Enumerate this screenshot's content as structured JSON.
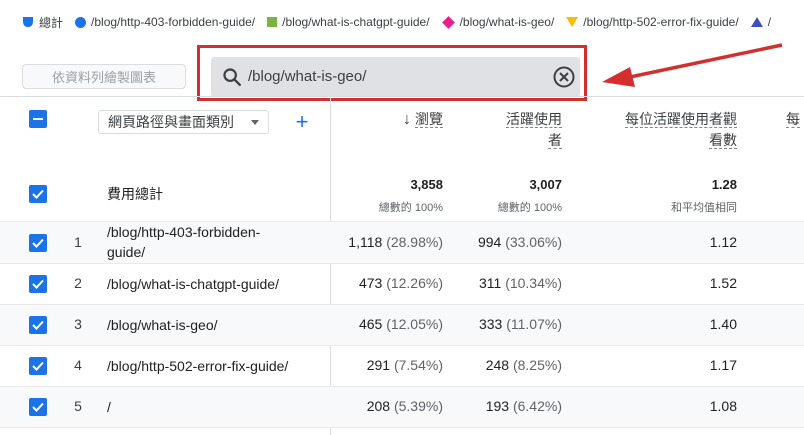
{
  "legend": [
    {
      "shape": "drop",
      "color": "#1a73e8",
      "label": "總計"
    },
    {
      "shape": "circle",
      "color": "#1a73e8",
      "label": "/blog/http-403-forbidden-guide/"
    },
    {
      "shape": "square",
      "color": "#7cb342",
      "label": "/blog/what-is-chatgpt-guide/"
    },
    {
      "shape": "diamond",
      "color": "#e91e8c",
      "label": "/blog/what-is-geo/"
    },
    {
      "shape": "tri-down",
      "color": "#fbbc04",
      "label": "/blog/http-502-error-fix-guide/"
    },
    {
      "shape": "tri-up",
      "color": "#3f51b5",
      "label": "/"
    }
  ],
  "toolbar": {
    "chart_button": "依資料列繪製圖表",
    "search_value": "/blog/what-is-geo/"
  },
  "colors": {
    "accent": "#1a73e8",
    "highlight": "#d32f2f",
    "annotation_arrow": "#d32f2f"
  },
  "table": {
    "dimension": "網頁路徑與畫面類別",
    "columns": [
      {
        "label": "瀏覽",
        "sorted": "desc",
        "sort_icon": "arrow-down-icon"
      },
      {
        "label_l1": "活躍使用",
        "label_l2": "者"
      },
      {
        "label_l1": "每位活躍使用者觀",
        "label_l2": "看數"
      },
      {
        "label": "每"
      }
    ],
    "totals": {
      "label": "費用總計",
      "views": "3,858",
      "views_sub": "總數的 100%",
      "users": "3,007",
      "users_sub": "總數的 100%",
      "per_user": "1.28",
      "per_user_sub": "和平均值相同"
    },
    "rows": [
      {
        "n": "1",
        "path_l1": "/blog/http-403-forbidden-",
        "path_l2": "guide/",
        "views": "1,118",
        "views_pct": "(28.98%)",
        "users": "994",
        "users_pct": "(33.06%)",
        "per_user": "1.12"
      },
      {
        "n": "2",
        "path_l1": "/blog/what-is-chatgpt-guide/",
        "path_l2": "",
        "views": "473",
        "views_pct": "(12.26%)",
        "users": "311",
        "users_pct": "(10.34%)",
        "per_user": "1.52"
      },
      {
        "n": "3",
        "path_l1": "/blog/what-is-geo/",
        "path_l2": "",
        "views": "465",
        "views_pct": "(12.05%)",
        "users": "333",
        "users_pct": "(11.07%)",
        "per_user": "1.40"
      },
      {
        "n": "4",
        "path_l1": "/blog/http-502-error-fix-guide/",
        "path_l2": "",
        "views": "291",
        "views_pct": "(7.54%)",
        "users": "248",
        "users_pct": "(8.25%)",
        "per_user": "1.17"
      },
      {
        "n": "5",
        "path_l1": "/",
        "path_l2": "",
        "views": "208",
        "views_pct": "(5.39%)",
        "users": "193",
        "users_pct": "(6.42%)",
        "per_user": "1.08"
      }
    ]
  }
}
